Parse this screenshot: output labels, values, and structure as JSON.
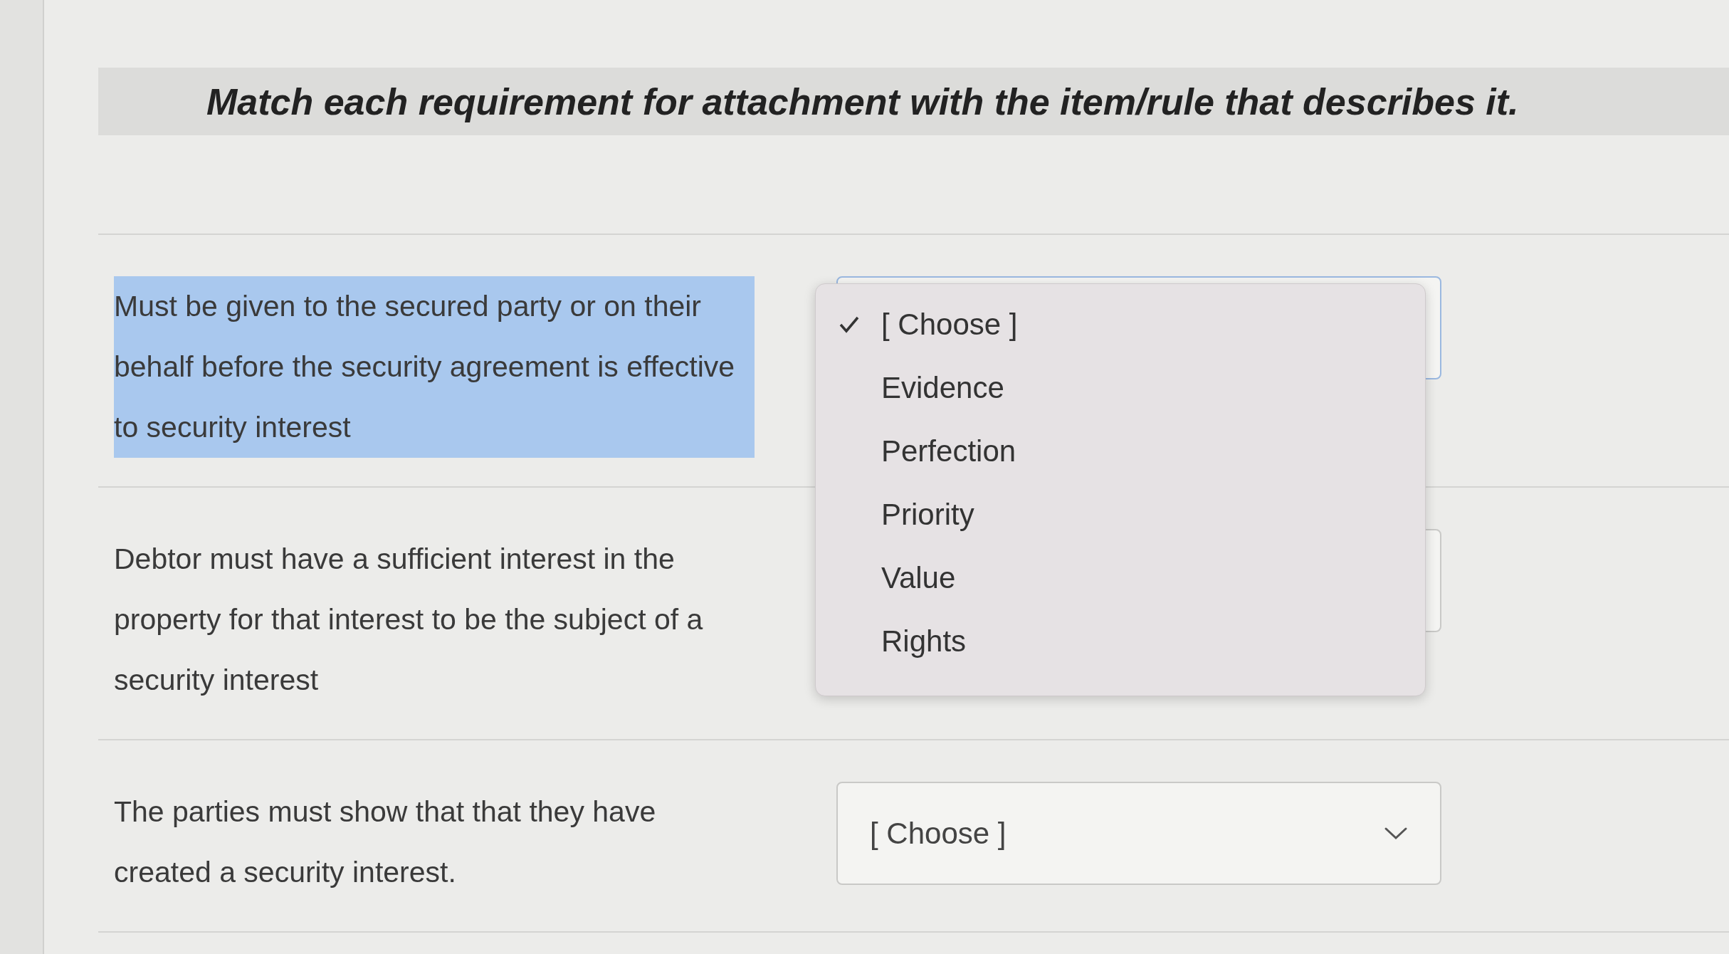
{
  "title": "Match each requirement for attachment with the item/rule that describes it.",
  "items": [
    {
      "prompt": "Must be given to the secured party or on their behalf before the security agreement is effective to security interest",
      "highlighted": true,
      "open": true,
      "menu_options": [
        {
          "label": "[ Choose ]",
          "selected": true
        },
        {
          "label": "Evidence",
          "selected": false
        },
        {
          "label": "Perfection",
          "selected": false
        },
        {
          "label": "Priority",
          "selected": false
        },
        {
          "label": "Value",
          "selected": false
        },
        {
          "label": "Rights",
          "selected": false
        }
      ]
    },
    {
      "prompt": "Debtor must have a sufficient interest in the property for that interest to be the subject of a security interest",
      "highlighted": false
    },
    {
      "prompt": "The parties must show that that they have created a security interest.",
      "highlighted": false,
      "value": "[ Choose ]"
    }
  ]
}
